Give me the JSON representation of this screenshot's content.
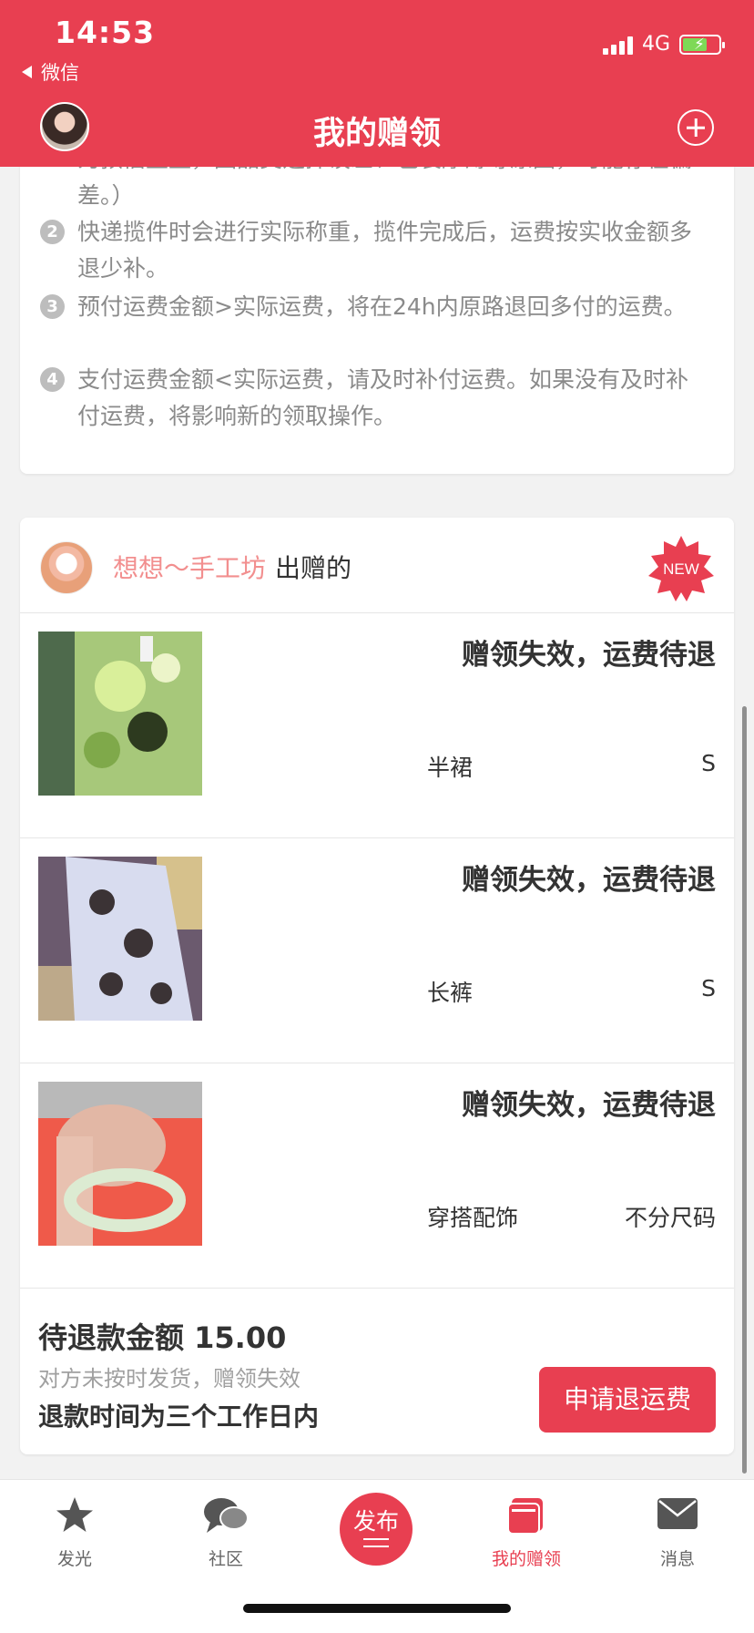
{
  "status_bar": {
    "time": "14:53",
    "back_label": "微信",
    "network": "4G"
  },
  "header": {
    "title": "我的赠领"
  },
  "info": {
    "lines": [
      "为预估重量，因品类选择误差、包装厚薄等原因，可能存在偏",
      "差。）",
      "快递揽件时会进行实际称重，揽件完成后，运费按实收金额多",
      "退少补。",
      "预付运费金额>实际运费，将在24h内原路退回多付的运费。",
      "支付运费金额<实际运费，请及时补付运费。如果没有及时补",
      "付运费，将影响新的领取操作。"
    ],
    "numbers": [
      "2",
      "3",
      "4"
    ]
  },
  "gift": {
    "giver_name": "想想～手工坊",
    "giver_suffix": "出赠的",
    "badge": "NEW",
    "items": [
      {
        "status": "赠领失效，运费待退",
        "category": "半裙",
        "size": "S"
      },
      {
        "status": "赠领失效，运费待退",
        "category": "长裤",
        "size": "S"
      },
      {
        "status": "赠领失效，运费待退",
        "category": "穿搭配饰",
        "size": "不分尺码"
      }
    ],
    "refund_amount": "待退款金额 15.00",
    "refund_reason": "对方未按时发货，赠领失效",
    "refund_time": "退款时间为三个工作日内",
    "refund_button": "申请退运费"
  },
  "tabbar": {
    "tabs": [
      {
        "label": "发光",
        "icon": "star-icon"
      },
      {
        "label": "社区",
        "icon": "chat-bubble-icon"
      },
      {
        "label": "发布",
        "icon": "publish-icon"
      },
      {
        "label": "我的赠领",
        "icon": "gift-book-icon",
        "active": true
      },
      {
        "label": "消息",
        "icon": "mail-icon"
      }
    ]
  },
  "colors": {
    "brand": "#e83f51",
    "giver_name": "#f28f8f"
  }
}
